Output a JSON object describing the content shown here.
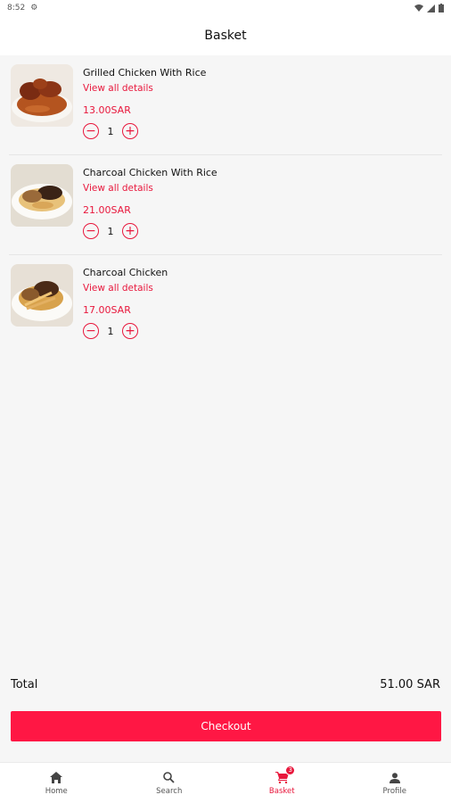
{
  "status_bar": {
    "time": "8:52"
  },
  "app_bar": {
    "title": "Basket"
  },
  "basket": {
    "items": [
      {
        "name": "Grilled Chicken With Rice",
        "details_link": "View all details",
        "price": "13.00SAR",
        "quantity": "1",
        "image": "grilled-chicken-rice-photo"
      },
      {
        "name": "Charcoal Chicken With Rice",
        "details_link": "View all details",
        "price": "21.00SAR",
        "quantity": "1",
        "image": "charcoal-chicken-rice-photo"
      },
      {
        "name": "Charcoal Chicken",
        "details_link": "View all details",
        "price": "17.00SAR",
        "quantity": "1",
        "image": "charcoal-chicken-photo"
      }
    ]
  },
  "summary": {
    "total_label": "Total",
    "total_value": "51.00 SAR"
  },
  "checkout": {
    "label": "Checkout"
  },
  "bottom_nav": {
    "items": [
      {
        "label": "Home",
        "icon": "home-icon"
      },
      {
        "label": "Search",
        "icon": "search-icon"
      },
      {
        "label": "Basket",
        "icon": "cart-icon",
        "badge": "3"
      },
      {
        "label": "Profile",
        "icon": "person-icon"
      }
    ]
  },
  "colors": {
    "accent": "#e8173c",
    "button": "#ff1744",
    "background": "#f6f6f6"
  }
}
